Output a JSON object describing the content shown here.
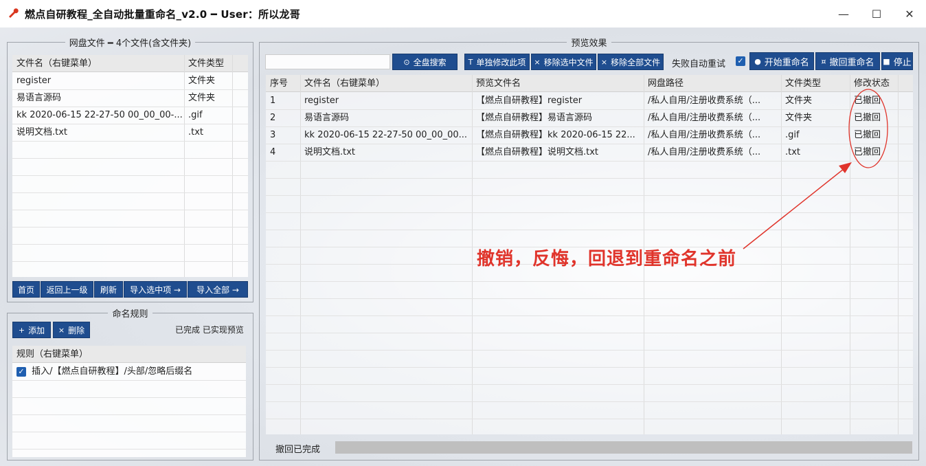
{
  "window": {
    "title": "燃点自研教程_全自动批量重命名_v2.0 ━ User：所以龙哥",
    "minimize_glyph": "—",
    "maximize_glyph": "☐",
    "close_glyph": "✕"
  },
  "left_panel": {
    "legend": "网盘文件 ━ 4个文件(含文件夹)",
    "columns": [
      "文件名（右键菜单）",
      "文件类型"
    ],
    "rows": [
      [
        "register",
        "文件夹"
      ],
      [
        "易语言源码",
        "文件夹"
      ],
      [
        "kk 2020-06-15 22-27-50 00_00_00-...",
        ".gif"
      ],
      [
        "说明文档.txt",
        ".txt"
      ]
    ],
    "buttons": {
      "home": "首页",
      "up": "返回上一级",
      "refresh": "刷新",
      "import_selected": "导入选中项 →",
      "import_all": "导入全部 →"
    }
  },
  "rules_panel": {
    "legend": "命名规则",
    "add_label": "添加",
    "delete_label": "删除",
    "add_glyph": "+",
    "delete_glyph": "×",
    "status": "已完成 已实现预览",
    "column": "规则（右键菜单）",
    "rules": [
      {
        "checked": true,
        "text": "插入/【燃点自研教程】/头部/忽略后缀名"
      }
    ]
  },
  "preview_panel": {
    "legend": "预览效果",
    "search_placeholder": "",
    "buttons": {
      "full_search": "全盘搜索",
      "edit_single": "单独修改此项",
      "remove_selected": "移除选中文件",
      "remove_all": "移除全部文件",
      "start_rename": "开始重命名",
      "undo_rename": "撤回重命名",
      "stop": "停止"
    },
    "glyphs": {
      "search": "⊙",
      "edit": "T",
      "remove": "×",
      "start": "●",
      "undo": "¤",
      "stop": "■",
      "check": "✓"
    },
    "retry_label": "失败自动重试",
    "retry_checked": true,
    "columns": [
      "序号",
      "文件名（右键菜单）",
      "预览文件名",
      "网盘路径",
      "文件类型",
      "修改状态"
    ],
    "rows": [
      [
        "1",
        "register",
        "【燃点自研教程】register",
        "/私人自用/注册收费系统（...",
        "文件夹",
        "已撤回"
      ],
      [
        "2",
        "易语言源码",
        "【燃点自研教程】易语言源码",
        "/私人自用/注册收费系统（...",
        "文件夹",
        "已撤回"
      ],
      [
        "3",
        "kk 2020-06-15 22-27-50 00_00_00...",
        "【燃点自研教程】kk 2020-06-15 22...",
        "/私人自用/注册收费系统（...",
        ".gif",
        "已撤回"
      ],
      [
        "4",
        "说明文档.txt",
        "【燃点自研教程】说明文档.txt",
        "/私人自用/注册收费系统（...",
        ".txt",
        "已撤回"
      ]
    ],
    "status_text": "撤回已完成"
  },
  "annotation": {
    "text": "撤销，反悔，回退到重命名之前",
    "color": "#e0342b"
  },
  "colors": {
    "button_bg": "#1f4d8f",
    "checkbox": "#1f5fb0"
  }
}
